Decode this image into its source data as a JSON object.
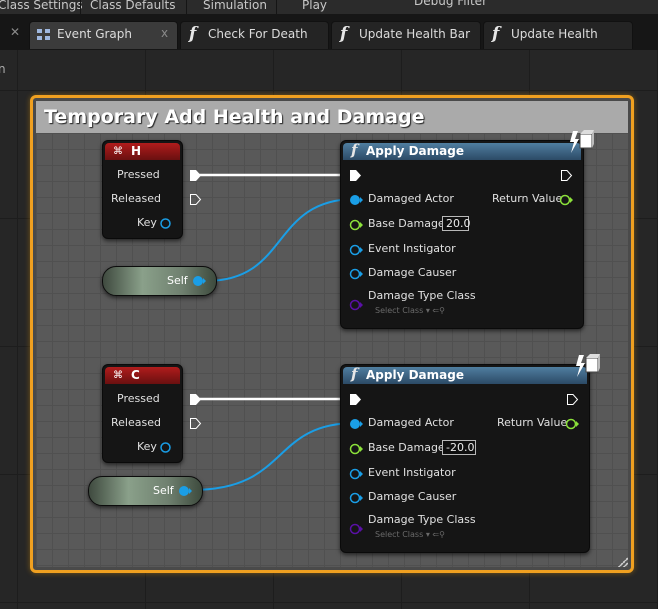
{
  "toolbar": {
    "items": [
      "Class Settings",
      "Class Defaults",
      "Simulation",
      "Play",
      "Debug Filter"
    ]
  },
  "tabs": [
    {
      "label": "Event Graph",
      "icon": "event-graph-icon",
      "active": true,
      "close": "x"
    },
    {
      "label": "Check For Death",
      "icon": "function-icon"
    },
    {
      "label": "Update Health Bar",
      "icon": "function-icon"
    },
    {
      "label": "Update Health",
      "icon": "function-icon"
    }
  ],
  "comment": {
    "title": "Temporary Add Health and Damage",
    "color": "#f0a020"
  },
  "key_h": {
    "title": "H",
    "pins": {
      "pressed": "Pressed",
      "released": "Released",
      "key": "Key"
    }
  },
  "key_c": {
    "title": "C",
    "pins": {
      "pressed": "Pressed",
      "released": "Released",
      "key": "Key"
    }
  },
  "self_1": {
    "label": "Self"
  },
  "self_2": {
    "label": "Self"
  },
  "apply_1": {
    "title": "Apply Damage",
    "icon": "function-icon",
    "pins": {
      "damaged_actor": "Damaged Actor",
      "base_damage": "Base Damage",
      "base_damage_value": "20.0",
      "event_instigator": "Event Instigator",
      "damage_causer": "Damage Causer",
      "damage_type_class": "Damage Type Class",
      "select_class": "Select Class",
      "return_value": "Return Value"
    }
  },
  "apply_2": {
    "title": "Apply Damage",
    "icon": "function-icon",
    "pins": {
      "damaged_actor": "Damaged Actor",
      "base_damage": "Base Damage",
      "base_damage_value": "-20.0",
      "event_instigator": "Event Instigator",
      "damage_causer": "Damage Causer",
      "damage_type_class": "Damage Type Class",
      "select_class": "Select Class",
      "return_value": "Return Value"
    }
  },
  "colors": {
    "object_pin": "#1a9ee6",
    "float_pin": "#8be13a",
    "class_pin": "#5a10a6",
    "exec": "#ffffff"
  }
}
